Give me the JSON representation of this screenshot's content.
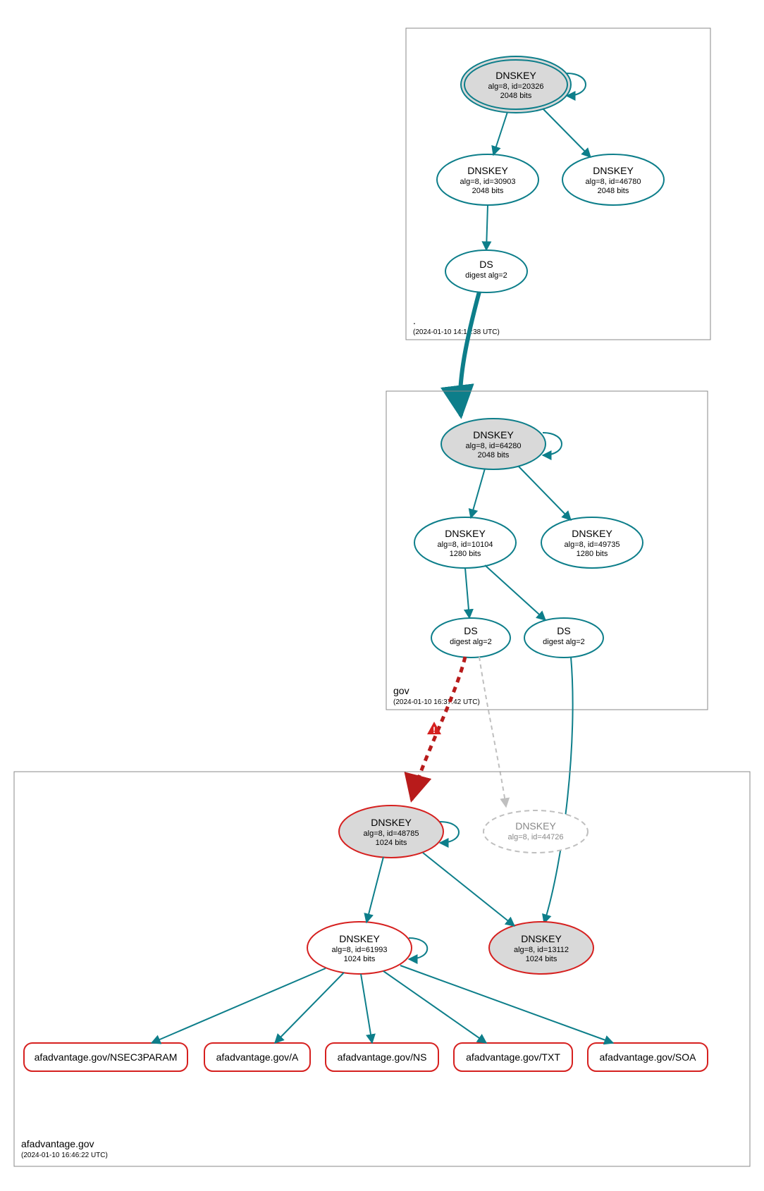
{
  "colors": {
    "teal": "#0d7e8a",
    "red": "#d6201f",
    "darkred": "#b81b1b",
    "grey": "#bfbfbf",
    "lightgrey": "#d9d9d9",
    "boxstroke": "#888888"
  },
  "zones": {
    "root": {
      "name": ".",
      "time": "(2024-01-10 14:14:38 UTC)"
    },
    "gov": {
      "name": "gov",
      "time": "(2024-01-10 16:37:42 UTC)"
    },
    "af": {
      "name": "afadvantage.gov",
      "time": "(2024-01-10 16:46:22 UTC)"
    }
  },
  "root_nodes": {
    "ksk": {
      "title": "DNSKEY",
      "l2": "alg=8, id=20326",
      "l3": "2048 bits"
    },
    "zsk1": {
      "title": "DNSKEY",
      "l2": "alg=8, id=30903",
      "l3": "2048 bits"
    },
    "zsk2": {
      "title": "DNSKEY",
      "l2": "alg=8, id=46780",
      "l3": "2048 bits"
    },
    "ds": {
      "title": "DS",
      "l2": "digest alg=2"
    }
  },
  "gov_nodes": {
    "ksk": {
      "title": "DNSKEY",
      "l2": "alg=8, id=64280",
      "l3": "2048 bits"
    },
    "zsk1": {
      "title": "DNSKEY",
      "l2": "alg=8, id=10104",
      "l3": "1280 bits"
    },
    "zsk2": {
      "title": "DNSKEY",
      "l2": "alg=8, id=49735",
      "l3": "1280 bits"
    },
    "ds1": {
      "title": "DS",
      "l2": "digest alg=2"
    },
    "ds2": {
      "title": "DS",
      "l2": "digest alg=2"
    }
  },
  "af_nodes": {
    "ksk": {
      "title": "DNSKEY",
      "l2": "alg=8, id=48785",
      "l3": "1024 bits"
    },
    "missing": {
      "title": "DNSKEY",
      "l2": "alg=8, id=44726"
    },
    "zsk": {
      "title": "DNSKEY",
      "l2": "alg=8, id=61993",
      "l3": "1024 bits"
    },
    "other": {
      "title": "DNSKEY",
      "l2": "alg=8, id=13112",
      "l3": "1024 bits"
    }
  },
  "rrsets": {
    "nsec3p": "afadvantage.gov/NSEC3PARAM",
    "a": "afadvantage.gov/A",
    "ns": "afadvantage.gov/NS",
    "txt": "afadvantage.gov/TXT",
    "soa": "afadvantage.gov/SOA"
  },
  "warning_glyph": "⚠"
}
